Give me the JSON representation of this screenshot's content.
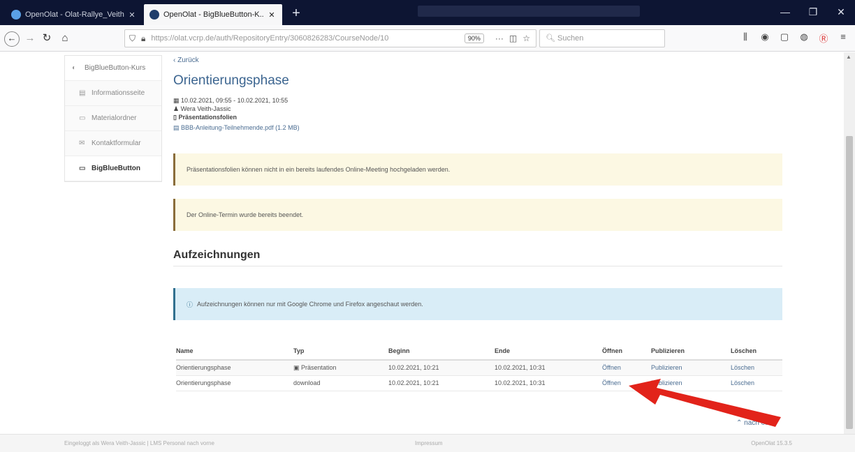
{
  "browser": {
    "tabs": [
      {
        "title": "OpenOlat - Olat-Rallye_Veith-...",
        "close": "✕"
      },
      {
        "title": "OpenOlat - BigBlueButton-K...",
        "close": "✕"
      }
    ],
    "new_tab": "+",
    "window_controls": [
      "—",
      "❐",
      "✕"
    ],
    "url": "https://olat.vcrp.de/auth/RepositoryEntry/3060826283/CourseNode/10",
    "zoom": "90%",
    "url_tools": [
      "···",
      "◫",
      "☆"
    ],
    "search_placeholder": "Suchen",
    "toolbar_icons": [
      "⫼",
      "◉",
      "▢",
      "◍",
      "Ⓡ",
      "≡"
    ]
  },
  "sidebar": {
    "root": {
      "label": "BigBlueButton-Kurs",
      "icon": "globe-icon"
    },
    "items": [
      {
        "label": "Informationsseite",
        "icon": "file-icon"
      },
      {
        "label": "Materialordner",
        "icon": "folder-icon"
      },
      {
        "label": "Kontaktformular",
        "icon": "envelope-icon"
      },
      {
        "label": "BigBlueButton",
        "icon": "monitor-icon"
      }
    ]
  },
  "main": {
    "back": "Zurück",
    "title": "Orientierungsphase",
    "date_range": "10.02.2021, 09:55 - 10.02.2021, 10:55",
    "user": "Wera Veith-Jassic",
    "slides_label": "Präsentationsfolien",
    "file": "BBB-Anleitung-Teilnehmende.pdf (1.2 MB)",
    "alert_upload": "Präsentationsfolien können nicht in ein bereits laufendes Online-Meeting hochgeladen werden.",
    "alert_ended": "Der Online-Termin wurde bereits beendet.",
    "recordings_title": "Aufzeichnungen",
    "alert_browser": "Aufzeichnungen können nur mit Google Chrome und Firefox angeschaut werden.",
    "table": {
      "headers": [
        "Name",
        "Typ",
        "Beginn",
        "Ende",
        "Öffnen",
        "Publizieren",
        "Löschen"
      ],
      "rows": [
        {
          "name": "Orientierungsphase",
          "typ": "Präsentation",
          "beginn": "10.02.2021, 10:21",
          "ende": "10.02.2021, 10:31",
          "open": "Öffnen",
          "publish": "Publizieren",
          "delete": "Löschen"
        },
        {
          "name": "Orientierungsphase",
          "typ": "download",
          "beginn": "10.02.2021, 10:21",
          "ende": "10.02.2021, 10:31",
          "open": "Öffnen",
          "publish": "Publizieren",
          "delete": "Löschen"
        }
      ]
    },
    "to_top": "nach oben"
  },
  "footer": {
    "left": "Eingeloggt als Wera Veith-Jassic | LMS Personal nach vorne",
    "center": "Impressum",
    "right": "OpenOlat 15.3.5"
  },
  "annotation": {
    "arrow_color": "#e2231a"
  }
}
